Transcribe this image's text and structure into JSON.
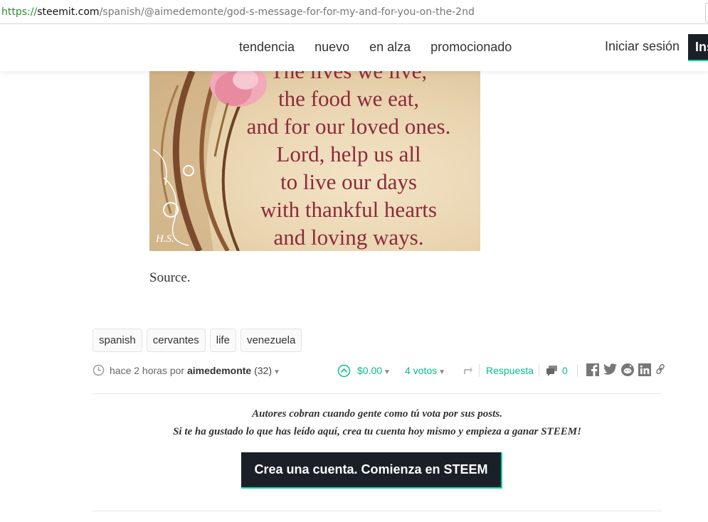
{
  "browser": {
    "url_protocol": "https://",
    "url_host": "steemit.com",
    "url_path": "/spanish/@aimedemonte/god-s-message-for-for-my-and-for-you-on-the-2nd"
  },
  "header": {
    "nav": [
      "tendencia",
      "nuevo",
      "en alza",
      "promocionado"
    ],
    "login": "Iniciar sesión",
    "signup": "Inscríbete"
  },
  "post": {
    "image": {
      "lines": [
        "The lives we live,",
        "the food we eat,",
        "and for our loved ones.",
        "Lord, help us all",
        "to live our days",
        "with thankful hearts",
        "and loving ways."
      ],
      "signature": "H.S."
    },
    "source_text": "Source."
  },
  "tags": [
    "spanish",
    "cervantes",
    "life",
    "venezuela"
  ],
  "meta": {
    "time": "hace 2 horas por",
    "author": "aimedemonte",
    "reputation": "(32)",
    "payout": "$0.00",
    "votes": "4 votos",
    "reply": "Respuesta",
    "comments": "0",
    "icons": [
      "clock-icon",
      "upvote-icon",
      "reblog-icon",
      "comments-icon",
      "facebook-icon",
      "twitter-icon",
      "reddit-icon",
      "linkedin-icon",
      "link-icon"
    ]
  },
  "promo": {
    "line1": "Autores cobran cuando gente como tú vota por sus posts.",
    "line2": "Si te ha gustado lo que has leído aquí, crea tu cuenta hoy mismo y empieza a ganar STEEM!",
    "cta": "Crea una cuenta. Comienza en STEEM"
  },
  "colors": {
    "accent": "#06bd8f",
    "dark": "#1a1f28",
    "quote": "#8c2a3b"
  }
}
